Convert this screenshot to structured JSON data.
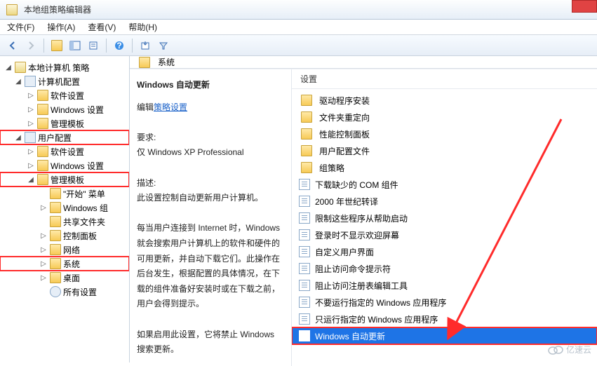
{
  "window": {
    "title": "本地组策略编辑器"
  },
  "menu": {
    "file": "文件(F)",
    "action": "操作(A)",
    "view": "查看(V)",
    "help": "帮助(H)"
  },
  "tree": {
    "root": "本地计算机 策略",
    "computer_config": "计算机配置",
    "cc_software": "软件设置",
    "cc_windows": "Windows 设置",
    "cc_admin": "管理模板",
    "user_config": "用户配置",
    "uc_software": "软件设置",
    "uc_windows": "Windows 设置",
    "uc_admin": "管理模板",
    "start_menu": "\"开始\" 菜单",
    "windows_comp": "Windows 组",
    "shared_folders": "共享文件夹",
    "control_panel": "控制面板",
    "network": "网络",
    "system": "系统",
    "desktop": "桌面",
    "all_settings": "所有设置"
  },
  "header": {
    "breadcrumb": "系统"
  },
  "desc": {
    "title": "Windows 自动更新",
    "edit_prefix": "编辑",
    "edit_link": "策略设置",
    "req_label": "要求:",
    "req_text": "仅 Windows XP Professional",
    "desc_label": "描述:",
    "desc_text1": "此设置控制自动更新用户计算机。",
    "desc_text2": "每当用户连接到 Internet 时，Windows 就会搜索用户计算机上的软件和硬件的可用更新，并自动下载它们。此操作在后台发生，根据配置的具体情况，在下载的组件准备好安装时或在下载之前，用户会得到提示。",
    "desc_text3": "如果启用此设置，它将禁止 Windows 搜索更新。"
  },
  "list": {
    "header": "设置",
    "items": [
      {
        "type": "folder",
        "label": "驱动程序安装"
      },
      {
        "type": "folder",
        "label": "文件夹重定向"
      },
      {
        "type": "folder",
        "label": "性能控制面板"
      },
      {
        "type": "folder",
        "label": "用户配置文件"
      },
      {
        "type": "folder",
        "label": "组策略"
      },
      {
        "type": "doc",
        "label": "下载缺少的 COM 组件"
      },
      {
        "type": "doc",
        "label": "2000 年世纪转译"
      },
      {
        "type": "doc",
        "label": "限制这些程序从帮助启动"
      },
      {
        "type": "doc",
        "label": "登录时不显示欢迎屏幕"
      },
      {
        "type": "doc",
        "label": "自定义用户界面"
      },
      {
        "type": "doc",
        "label": "阻止访问命令提示符"
      },
      {
        "type": "doc",
        "label": "阻止访问注册表编辑工具"
      },
      {
        "type": "doc",
        "label": "不要运行指定的 Windows 应用程序"
      },
      {
        "type": "doc",
        "label": "只运行指定的 Windows 应用程序"
      },
      {
        "type": "doc",
        "label": "Windows 自动更新",
        "selected": true
      }
    ]
  },
  "watermark": "亿速云"
}
